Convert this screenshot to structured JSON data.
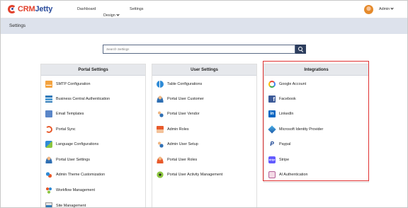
{
  "header": {
    "logo_part1": "CRM",
    "logo_part2": "Jetty",
    "nav": [
      "Dashboard",
      "Design",
      "Settings"
    ],
    "user": "Admin"
  },
  "page_title": "Settings",
  "search": {
    "placeholder": "Search Settings"
  },
  "panels": [
    {
      "title": "Portal Settings",
      "items": [
        {
          "label": "SMTP Configuration",
          "icon": "mail-settings-icon"
        },
        {
          "label": "Business Central Authentication",
          "icon": "business-central-icon"
        },
        {
          "label": "Email Templates",
          "icon": "email-template-icon"
        },
        {
          "label": "Portal Sync",
          "icon": "sync-icon"
        },
        {
          "label": "Language Configurations",
          "icon": "language-icon"
        },
        {
          "label": "Portal User Settings",
          "icon": "user-settings-icon"
        },
        {
          "label": "Admin Theme Customization",
          "icon": "theme-icon"
        },
        {
          "label": "Workflow Management",
          "icon": "workflow-icon"
        },
        {
          "label": "Site Management",
          "icon": "site-icon"
        }
      ]
    },
    {
      "title": "User Settings",
      "items": [
        {
          "label": "Table Configurations",
          "icon": "table-config-icon"
        },
        {
          "label": "Portal User Customer",
          "icon": "user-customer-icon"
        },
        {
          "label": "Portal User Vendor",
          "icon": "user-vendor-icon"
        },
        {
          "label": "Admin Roles",
          "icon": "admin-roles-icon"
        },
        {
          "label": "Admin User Setup",
          "icon": "admin-user-setup-icon"
        },
        {
          "label": "Portal User Roles",
          "icon": "user-roles-icon"
        },
        {
          "label": "Portal User Activity Management",
          "icon": "activity-icon"
        }
      ]
    },
    {
      "title": "Integrations",
      "items": [
        {
          "label": "Google Account",
          "icon": "google-icon"
        },
        {
          "label": "Facebook",
          "icon": "facebook-icon"
        },
        {
          "label": "LinkedIn",
          "icon": "linkedin-icon"
        },
        {
          "label": "Microsoft Identity Provider",
          "icon": "microsoft-identity-icon"
        },
        {
          "label": "Paypal",
          "icon": "paypal-icon"
        },
        {
          "label": "Stripe",
          "icon": "stripe-icon"
        },
        {
          "label": "AI Authentication",
          "icon": "ai-authentication-icon"
        }
      ]
    }
  ],
  "colors": {
    "highlight": "#e03131",
    "title_bar": "#dde2ec",
    "search_button": "#2d3e5e"
  }
}
